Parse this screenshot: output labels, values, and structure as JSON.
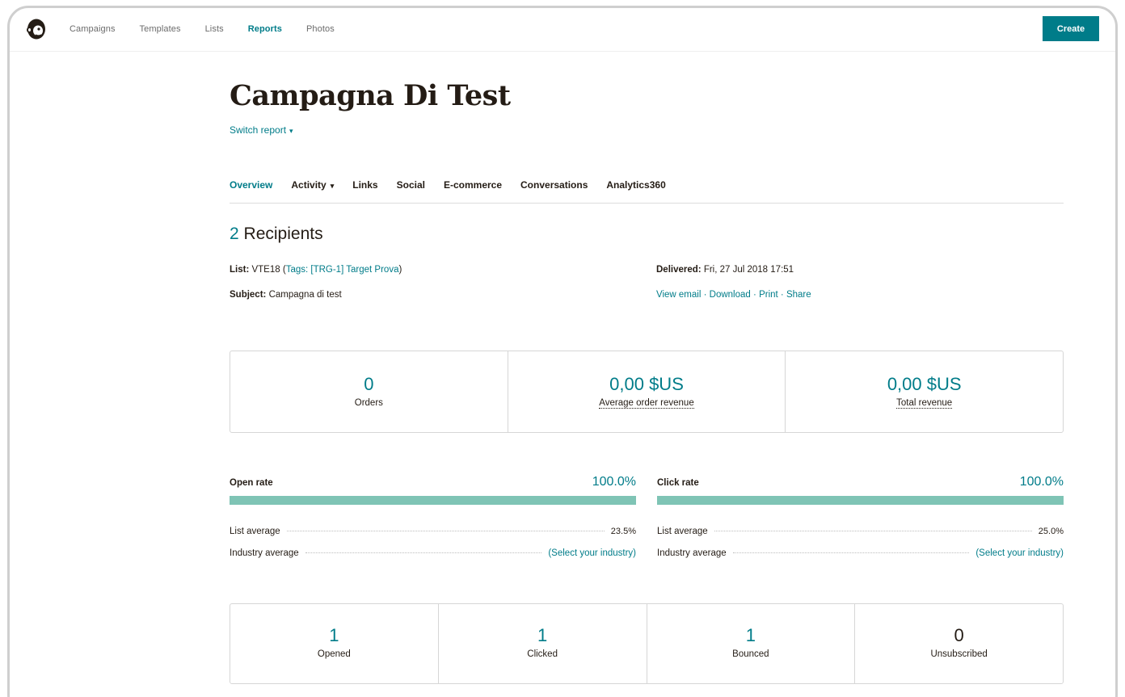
{
  "nav": {
    "items": [
      {
        "label": "Campaigns",
        "active": false
      },
      {
        "label": "Templates",
        "active": false
      },
      {
        "label": "Lists",
        "active": false
      },
      {
        "label": "Reports",
        "active": true
      },
      {
        "label": "Photos",
        "active": false
      }
    ],
    "create_label": "Create",
    "logo_icon": "monkey-logo-icon"
  },
  "report": {
    "title": "Campagna Di Test",
    "switch_label": "Switch report"
  },
  "tabs": [
    {
      "label": "Overview",
      "active": true,
      "dropdown": false
    },
    {
      "label": "Activity",
      "active": false,
      "dropdown": true
    },
    {
      "label": "Links",
      "active": false,
      "dropdown": false
    },
    {
      "label": "Social",
      "active": false,
      "dropdown": false
    },
    {
      "label": "E-commerce",
      "active": false,
      "dropdown": false
    },
    {
      "label": "Conversations",
      "active": false,
      "dropdown": false
    },
    {
      "label": "Analytics360",
      "active": false,
      "dropdown": false
    }
  ],
  "recipients": {
    "count": "2",
    "label": "Recipients"
  },
  "meta": {
    "list_label": "List:",
    "list_value": "VTE18",
    "tags_open": "(",
    "tags_text": "Tags: [TRG-1] Target Prova",
    "tags_close": ")",
    "subject_label": "Subject:",
    "subject_value": "Campagna di test",
    "delivered_label": "Delivered:",
    "delivered_value": "Fri, 27 Jul 2018 17:51",
    "actions": [
      "View email",
      "Download",
      "Print",
      "Share"
    ],
    "separator": "·"
  },
  "ecommerce": [
    {
      "value": "0",
      "label": "Orders",
      "dotted": false
    },
    {
      "value": "0,00 $US",
      "label": "Average order revenue",
      "dotted": true
    },
    {
      "value": "0,00 $US",
      "label": "Total revenue",
      "dotted": true
    }
  ],
  "rates": [
    {
      "title": "Open rate",
      "percent": "100.0%",
      "fill": 1.0,
      "list_avg_label": "List average",
      "list_avg_value": "23.5%",
      "industry_label": "Industry average",
      "industry_value": "(Select your industry)"
    },
    {
      "title": "Click rate",
      "percent": "100.0%",
      "fill": 1.0,
      "list_avg_label": "List average",
      "list_avg_value": "25.0%",
      "industry_label": "Industry average",
      "industry_value": "(Select your industry)"
    }
  ],
  "counts": [
    {
      "value": "1",
      "label": "Opened"
    },
    {
      "value": "1",
      "label": "Clicked"
    },
    {
      "value": "1",
      "label": "Bounced"
    },
    {
      "value": "0",
      "label": "Unsubscribed"
    }
  ],
  "colors": {
    "accent": "#007c89",
    "bar_fill": "#7fc4b5",
    "bar_track": "#e6f2f1"
  }
}
